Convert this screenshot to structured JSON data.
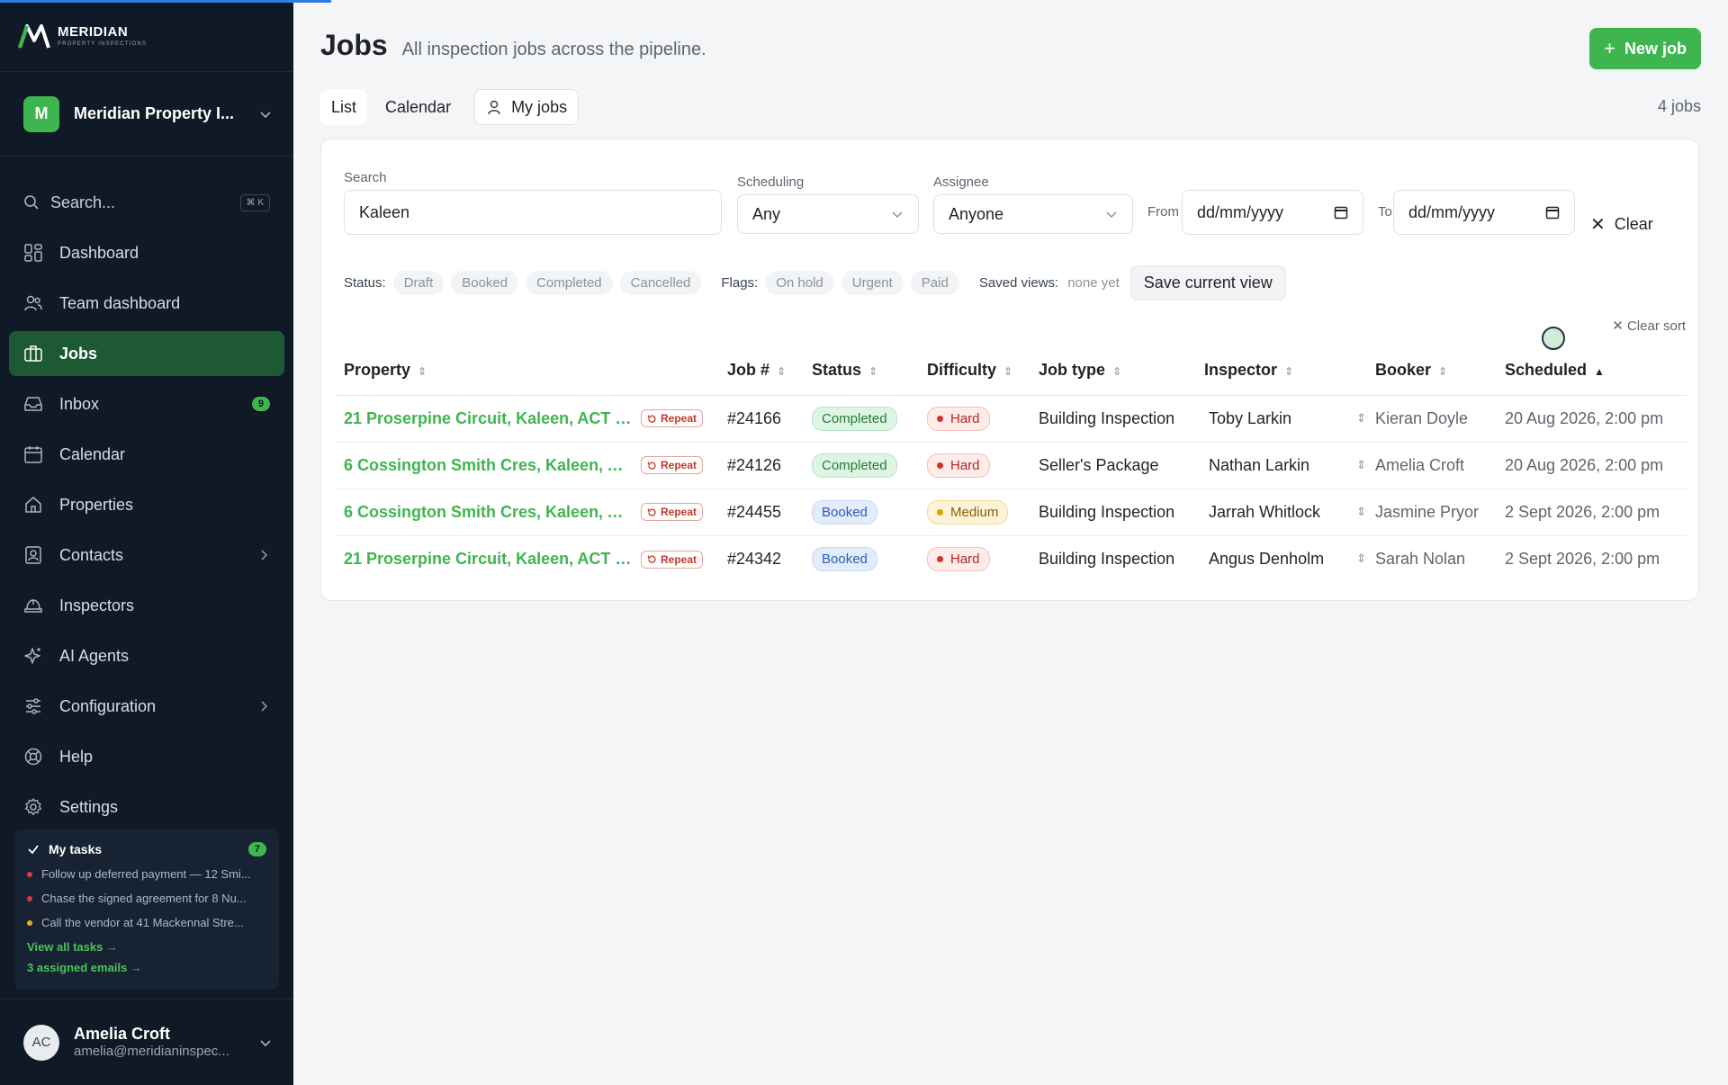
{
  "brand": {
    "name": "MERIDIAN",
    "sub": "PROPERTY INSPECTIONS"
  },
  "org": {
    "initial": "M",
    "name": "Meridian Property I..."
  },
  "search": {
    "label": "Search...",
    "shortcut": "⌘ K"
  },
  "nav": [
    {
      "label": "Dashboard",
      "icon": "dashboard-icon"
    },
    {
      "label": "Team dashboard",
      "icon": "team-icon"
    },
    {
      "label": "Jobs",
      "icon": "briefcase-icon",
      "active": true
    },
    {
      "label": "Inbox",
      "icon": "inbox-icon",
      "badge": "9"
    },
    {
      "label": "Calendar",
      "icon": "calendar-icon"
    },
    {
      "label": "Properties",
      "icon": "home-icon"
    },
    {
      "label": "Contacts",
      "icon": "contacts-icon",
      "chevron": true
    },
    {
      "label": "Inspectors",
      "icon": "hardhat-icon"
    },
    {
      "label": "AI Agents",
      "icon": "sparkles-icon"
    },
    {
      "label": "Configuration",
      "icon": "sliders-icon",
      "chevron": true
    },
    {
      "label": "Help",
      "icon": "lifebuoy-icon"
    },
    {
      "label": "Settings",
      "icon": "gear-icon"
    }
  ],
  "tasks": {
    "title": "My tasks",
    "count": "7",
    "items": [
      {
        "text": "Follow up deferred payment — 12 Smi...",
        "color": "#e53935"
      },
      {
        "text": "Chase the signed agreement for 8 Nu...",
        "color": "#e53935"
      },
      {
        "text": "Call the vendor at 41 Mackennal Stre...",
        "color": "#f5a623"
      }
    ],
    "view_all": "View all tasks →",
    "emails": "3 assigned emails →"
  },
  "user": {
    "initials": "AC",
    "name": "Amelia Croft",
    "email": "amelia@meridianinspec..."
  },
  "page": {
    "title": "Jobs",
    "subtitle": "All inspection jobs across the pipeline.",
    "new_job": "New job",
    "tabs": {
      "list": "List",
      "calendar": "Calendar",
      "my_jobs": "My jobs"
    },
    "count": "4 jobs"
  },
  "filters": {
    "search_label": "Search",
    "search_value": "Kaleen",
    "scheduling_label": "Scheduling",
    "scheduling_value": "Any",
    "assignee_label": "Assignee",
    "assignee_value": "Anyone",
    "from_label": "From",
    "from_placeholder": "dd/mm/yyyy",
    "to_label": "To",
    "to_placeholder": "dd/mm/yyyy",
    "clear": "Clear",
    "status_label": "Status:",
    "statuses": [
      "Draft",
      "Booked",
      "Completed",
      "Cancelled"
    ],
    "flags_label": "Flags:",
    "flags": [
      "On hold",
      "Urgent",
      "Paid"
    ],
    "saved_label": "Saved views:",
    "saved_none": "none yet",
    "save_view": "Save current view",
    "clear_sort": "Clear sort"
  },
  "table": {
    "headers": [
      "Property",
      "Job #",
      "Status",
      "Difficulty",
      "Job type",
      "Inspector",
      "Booker",
      "Scheduled"
    ],
    "repeat_label": "Repeat",
    "rows": [
      {
        "property": "21 Proserpine Circuit, Kaleen, ACT 2...",
        "job": "#24166",
        "status": "Completed",
        "difficulty": "Hard",
        "type": "Building Inspection",
        "inspector": "Toby Larkin",
        "booker": "Kieran Doyle",
        "scheduled": "20 Aug 2026, 2:00 pm"
      },
      {
        "property": "6 Cossington Smith Cres, Kaleen, A...",
        "job": "#24126",
        "status": "Completed",
        "difficulty": "Hard",
        "type": "Seller's Package",
        "inspector": "Nathan Larkin",
        "booker": "Amelia Croft",
        "scheduled": "20 Aug 2026, 2:00 pm"
      },
      {
        "property": "6 Cossington Smith Cres, Kaleen, A...",
        "job": "#24455",
        "status": "Booked",
        "difficulty": "Medium",
        "type": "Building Inspection",
        "inspector": "Jarrah Whitlock",
        "booker": "Jasmine Pryor",
        "scheduled": "2 Sept 2026, 2:00 pm"
      },
      {
        "property": "21 Proserpine Circuit, Kaleen, ACT 2...",
        "job": "#24342",
        "status": "Booked",
        "difficulty": "Hard",
        "type": "Building Inspection",
        "inspector": "Angus Denholm",
        "booker": "Sarah Nolan",
        "scheduled": "2 Sept 2026, 2:00 pm"
      }
    ]
  },
  "colors": {
    "accent": "#3fb54f",
    "sidebar": "#0f1a26",
    "active_nav": "#1d5a34"
  }
}
